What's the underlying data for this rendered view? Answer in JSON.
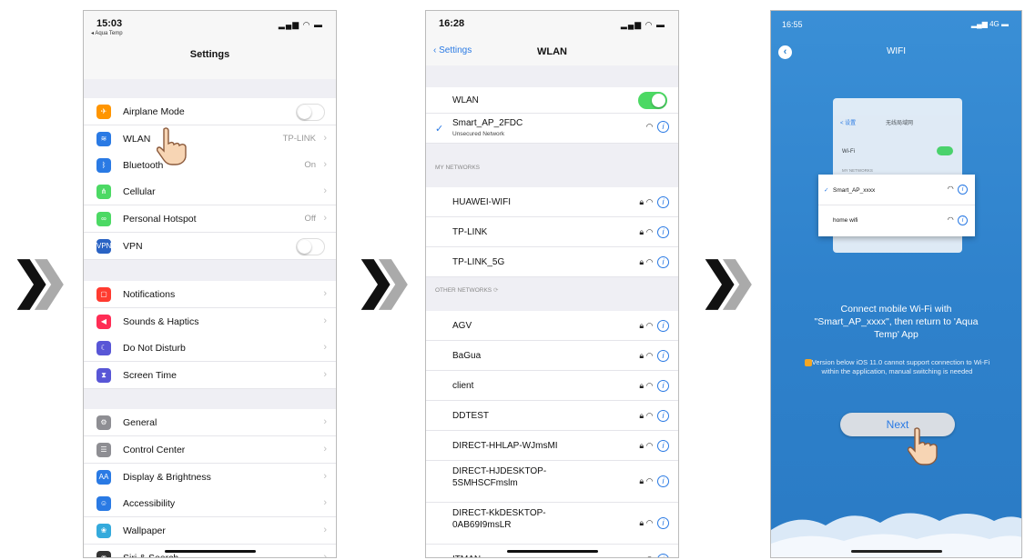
{
  "screen1": {
    "time": "15:03",
    "back": "◂ Aqua Temp",
    "title": "Settings",
    "items": [
      {
        "label": "Airplane Mode",
        "value": "",
        "color": "#ff9500",
        "glyph": "✈",
        "toggle": true
      },
      {
        "label": "WLAN",
        "value": "TP-LINK",
        "color": "#2a7ae4",
        "glyph": "≋"
      },
      {
        "label": "Bluetooth",
        "value": "On",
        "color": "#2a7ae4",
        "glyph": "ᛒ"
      },
      {
        "label": "Cellular",
        "value": "",
        "color": "#4cd964",
        "glyph": "⋔"
      },
      {
        "label": "Personal Hotspot",
        "value": "Off",
        "color": "#4cd964",
        "glyph": "∞"
      },
      {
        "label": "VPN",
        "value": "",
        "color": "#2a63c4",
        "glyph": "VPN",
        "toggle": true
      },
      {
        "label": "Notifications",
        "value": "",
        "color": "#ff3b30",
        "glyph": "▢"
      },
      {
        "label": "Sounds & Haptics",
        "value": "",
        "color": "#ff2d55",
        "glyph": "◀"
      },
      {
        "label": "Do Not Disturb",
        "value": "",
        "color": "#5856d6",
        "glyph": "☾"
      },
      {
        "label": "Screen Time",
        "value": "",
        "color": "#5856d6",
        "glyph": "⧗"
      },
      {
        "label": "General",
        "value": "",
        "color": "#8e8e93",
        "glyph": "⚙"
      },
      {
        "label": "Control Center",
        "value": "",
        "color": "#8e8e93",
        "glyph": "☰"
      },
      {
        "label": "Display & Brightness",
        "value": "",
        "color": "#2a7ae4",
        "glyph": "AA"
      },
      {
        "label": "Accessibility",
        "value": "",
        "color": "#2a7ae4",
        "glyph": "☺"
      },
      {
        "label": "Wallpaper",
        "value": "",
        "color": "#34aadc",
        "glyph": "❀"
      },
      {
        "label": "Siri & Search",
        "value": "",
        "color": "#333",
        "glyph": "◉"
      }
    ]
  },
  "screen2": {
    "time": "16:28",
    "back": "Settings",
    "title": "WLAN",
    "wlan_label": "WLAN",
    "connected": {
      "name": "Smart_AP_2FDC",
      "sub": "Unsecured Network"
    },
    "my_header": "MY NETWORKS",
    "other_header": "OTHER NETWORKS",
    "my_networks": [
      "HUAWEI-WIFI",
      "TP-LINK",
      "TP-LINK_5G"
    ],
    "other_networks": [
      "AGV",
      "BaGua",
      "client",
      "DDTEST",
      "DIRECT-HHLAP-WJmsMI",
      "DIRECT-HJDESKTOP-5SMHSCFmslm",
      "DIRECT-KkDESKTOP-0AB69I9msLR",
      "ITMAN"
    ]
  },
  "screen3": {
    "time": "16:55",
    "net": "4G",
    "title": "WIFI",
    "mini": {
      "back": "< 设置",
      "title": "无线局域网",
      "wlan": "Wi-Fi",
      "my": "MY NETWORKS",
      "net1": "Smart_AP_xxxx",
      "net2": "home wifi"
    },
    "message": "Connect mobile Wi-Fi with \"Smart_AP_xxxx\", then return to 'Aqua Temp' App",
    "warning": "Version below iOS 11.0 cannot support connection to Wi-Fi within the application, manual switching is needed",
    "next": "Next"
  },
  "arrows": "❯❯"
}
